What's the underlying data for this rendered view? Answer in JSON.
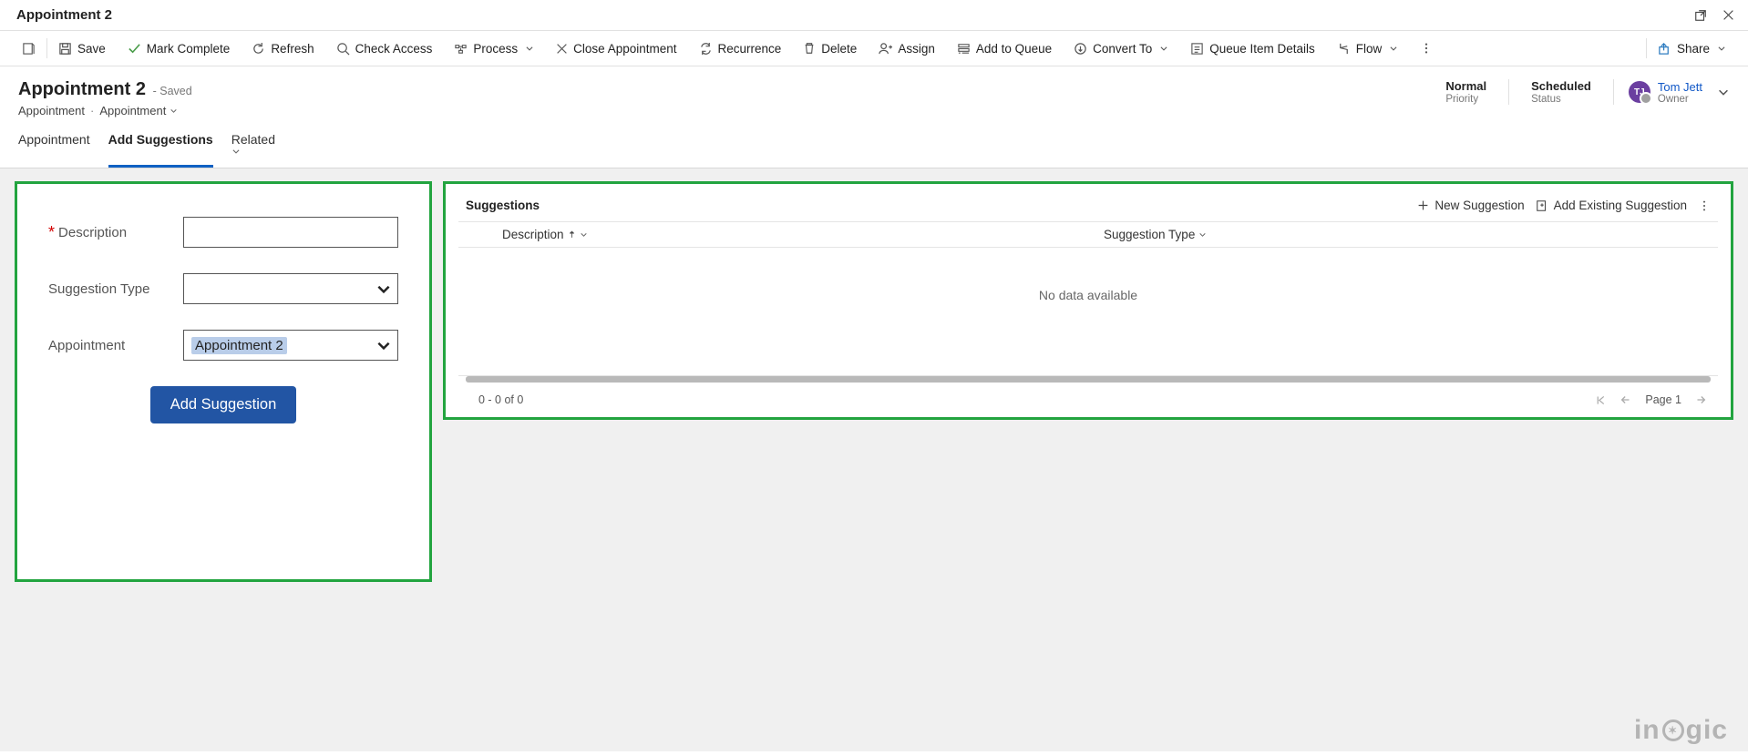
{
  "window_title": "Appointment 2",
  "cmdbar": {
    "save": "Save",
    "mark_complete": "Mark Complete",
    "refresh": "Refresh",
    "check_access": "Check Access",
    "process": "Process",
    "close_appointment": "Close Appointment",
    "recurrence": "Recurrence",
    "delete": "Delete",
    "assign": "Assign",
    "add_to_queue": "Add to Queue",
    "convert_to": "Convert To",
    "queue_item_details": "Queue Item Details",
    "flow": "Flow",
    "share": "Share"
  },
  "record": {
    "title": "Appointment 2",
    "saved_tag": "- Saved",
    "breadcrumb_entity": "Appointment",
    "breadcrumb_form": "Appointment",
    "priority_label": "Priority",
    "priority_value": "Normal",
    "status_label": "Status",
    "status_value": "Scheduled",
    "owner_label": "Owner",
    "owner_name": "Tom Jett",
    "owner_initials": "TJ"
  },
  "tabs": {
    "appointment": "Appointment",
    "add_suggestions": "Add Suggestions",
    "related": "Related"
  },
  "form": {
    "description_label": "Description",
    "description_value": "",
    "suggestion_type_label": "Suggestion Type",
    "suggestion_type_value": "",
    "appointment_label": "Appointment",
    "appointment_value": "Appointment 2",
    "submit": "Add Suggestion"
  },
  "grid": {
    "title": "Suggestions",
    "new_suggestion": "New Suggestion",
    "add_existing_suggestion": "Add Existing Suggestion",
    "col_description": "Description",
    "col_suggestion_type": "Suggestion Type",
    "empty": "No data available",
    "range": "0 - 0 of 0",
    "page": "Page 1"
  },
  "watermark": "inogic"
}
